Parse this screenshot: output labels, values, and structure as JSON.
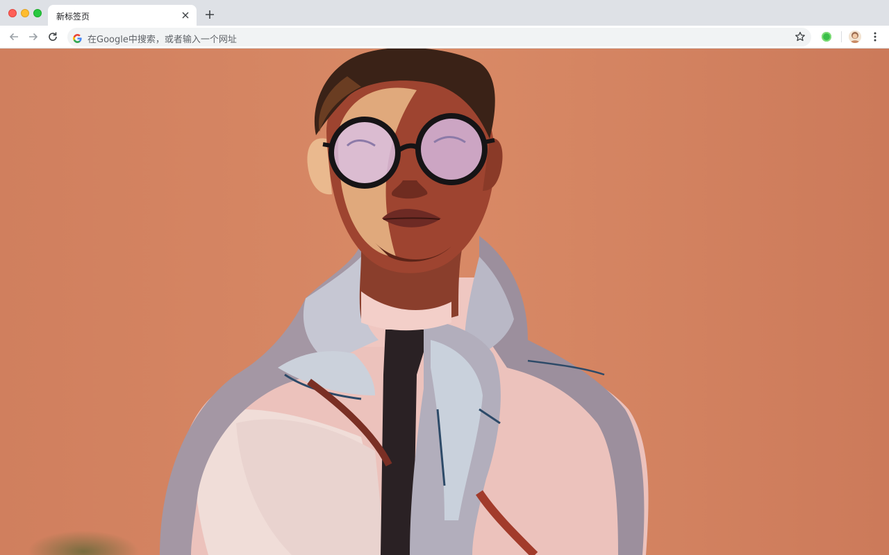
{
  "window": {
    "traffic_lights": [
      "close",
      "minimize",
      "maximize"
    ]
  },
  "tabs": [
    {
      "title": "新标签页",
      "active": true,
      "close_icon": "close-icon"
    }
  ],
  "new_tab_icon": "plus-icon",
  "toolbar": {
    "back_icon": "arrow-left-icon",
    "forward_icon": "arrow-right-icon",
    "reload_icon": "reload-icon",
    "omnibox": {
      "provider_icon": "google-g-icon",
      "placeholder": "在Google中搜索，或者输入一个网址"
    },
    "bookmark_icon": "star-icon",
    "extension_icon": "green-circle-extension-icon",
    "profile_icon": "avatar-icon",
    "menu_icon": "three-dot-menu-icon"
  },
  "wallpaper": {
    "description_icon": "illustration-person-with-glasses-and-scarf",
    "background_color": "#d4825f"
  }
}
